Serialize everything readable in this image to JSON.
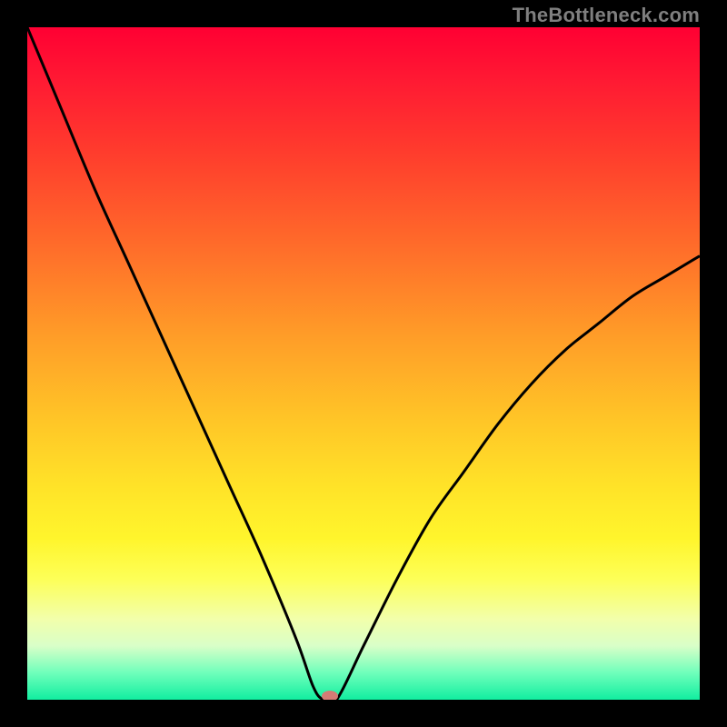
{
  "watermark": "TheBottleneck.com",
  "chart_data": {
    "type": "line",
    "title": "",
    "xlabel": "",
    "ylabel": "",
    "xlim": [
      0,
      1
    ],
    "ylim": [
      0,
      1
    ],
    "optimum_x": 0.44,
    "marker": {
      "x": 0.45,
      "y": 0.0,
      "color": "#d37b75"
    },
    "series": [
      {
        "name": "bottleneck-curve",
        "x": [
          0.0,
          0.05,
          0.1,
          0.15,
          0.2,
          0.25,
          0.3,
          0.35,
          0.4,
          0.425,
          0.44,
          0.46,
          0.5,
          0.55,
          0.6,
          0.65,
          0.7,
          0.75,
          0.8,
          0.85,
          0.9,
          0.95,
          1.0
        ],
        "y": [
          1.0,
          0.88,
          0.76,
          0.65,
          0.54,
          0.43,
          0.32,
          0.21,
          0.09,
          0.02,
          0.0,
          0.0,
          0.08,
          0.18,
          0.27,
          0.34,
          0.41,
          0.47,
          0.52,
          0.56,
          0.6,
          0.63,
          0.66
        ]
      }
    ],
    "colors": {
      "background_top": "#ff0033",
      "background_bottom": "#11eea0",
      "curve": "#000000",
      "frame": "#000000"
    }
  }
}
